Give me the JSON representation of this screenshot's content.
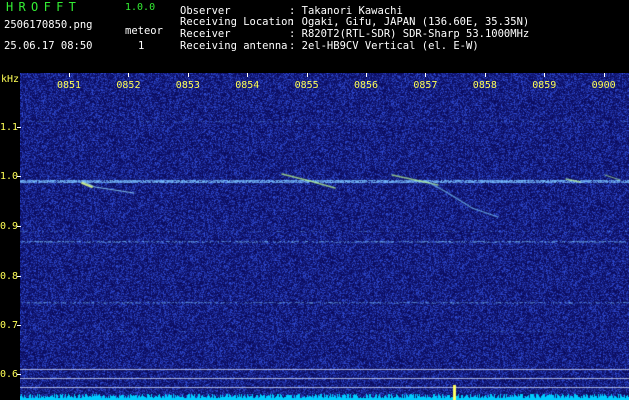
{
  "header": {
    "app_name": "HROFFT",
    "app_version": "1.0.0",
    "file_name": "2506170850.png",
    "date_time": "25.06.17 08:50",
    "meteor_label": "meteor",
    "meteor_count": "1",
    "info": [
      {
        "label": "Observer",
        "value": ": Takanori Kawachi"
      },
      {
        "label": "Receiving Location",
        "value": ": Ogaki, Gifu, JAPAN (136.60E, 35.35N)"
      },
      {
        "label": "Receiver",
        "value": ": R820T2(RTL-SDR) SDR-Sharp 53.1000MHz"
      },
      {
        "label": "Receiving antenna",
        "value": ": 2el-HB9CV Vertical (el. E-W)"
      }
    ]
  },
  "axes": {
    "y_unit": "kHz",
    "y_ticks": [
      "1.1",
      "1.0",
      "0.9",
      "0.8",
      "0.7",
      "0.6"
    ],
    "x_ticks": [
      "0851",
      "0852",
      "0853",
      "0854",
      "0855",
      "0856",
      "0857",
      "0858",
      "0859",
      "0900"
    ]
  },
  "colors": {
    "background": "#000000",
    "spectrogram_base": "#1a1a8c",
    "signal": "#7ec8ff",
    "meteor_trace": "#c8ff80",
    "tick_label": "#ffff55",
    "header_text": "#ffffff",
    "app_name": "#33ee33",
    "level_bar": "#00ccff"
  }
}
